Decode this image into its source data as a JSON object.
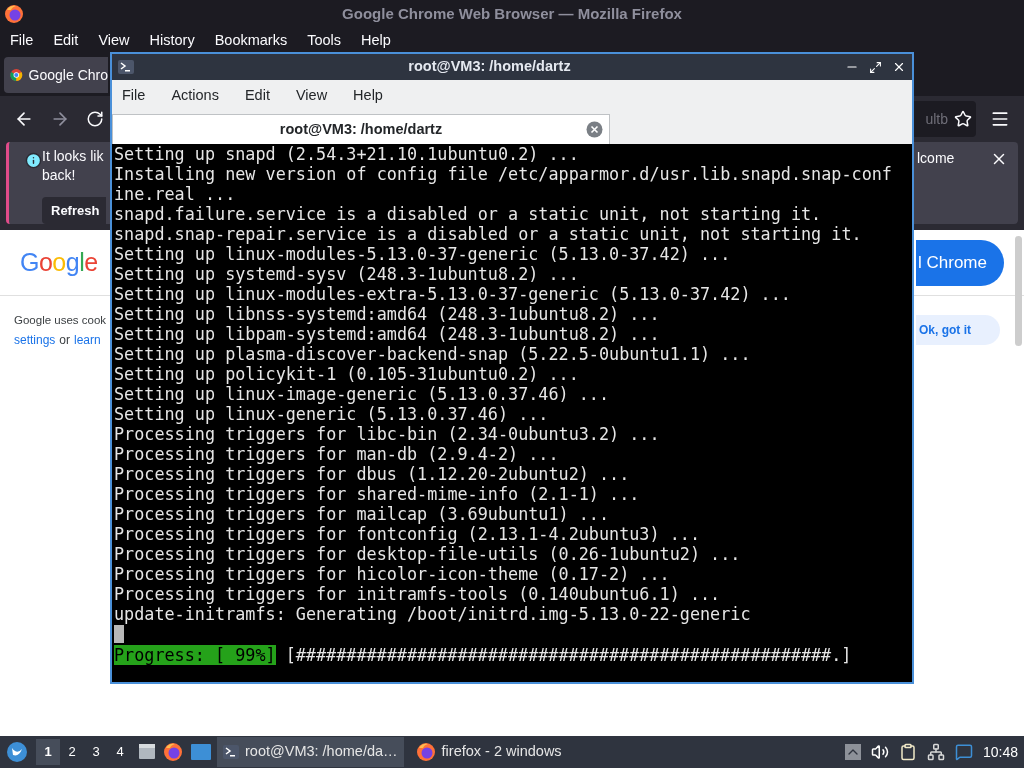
{
  "firefox": {
    "title": "Google Chrome Web Browser — Mozilla Firefox",
    "menu": [
      "File",
      "Edit",
      "View",
      "History",
      "Bookmarks",
      "Tools",
      "Help"
    ],
    "tab": {
      "label": "Google Chro"
    },
    "url_fragment": "ultb",
    "notification": {
      "lines": [
        "It looks lik",
        "back!"
      ],
      "button": "Refresh",
      "fragment": "lcome"
    },
    "page": {
      "logo": "Google",
      "install_button": "l Chrome",
      "cookie_text": "Google uses cook",
      "cookie_links": [
        {
          "text": "settings",
          "kind": "link"
        },
        {
          "text": "or",
          "kind": "plain"
        },
        {
          "text": "learn",
          "kind": "link"
        }
      ],
      "ok_button": "Ok, got it"
    }
  },
  "terminal": {
    "title": "root@VM3: /home/dartz",
    "menu": [
      "File",
      "Actions",
      "Edit",
      "View",
      "Help"
    ],
    "tab": {
      "label": "root@VM3: /home/dartz"
    },
    "lines": [
      "Setting up snapd (2.54.3+21.10.1ubuntu0.2) ...",
      "Installing new version of config file /etc/apparmor.d/usr.lib.snapd.snap-conf",
      "ine.real ...",
      "snapd.failure.service is a disabled or a static unit, not starting it.",
      "snapd.snap-repair.service is a disabled or a static unit, not starting it.",
      "Setting up linux-modules-5.13.0-37-generic (5.13.0-37.42) ...",
      "Setting up systemd-sysv (248.3-1ubuntu8.2) ...",
      "Setting up linux-modules-extra-5.13.0-37-generic (5.13.0-37.42) ...",
      "Setting up libnss-systemd:amd64 (248.3-1ubuntu8.2) ...",
      "Setting up libpam-systemd:amd64 (248.3-1ubuntu8.2) ...",
      "Setting up plasma-discover-backend-snap (5.22.5-0ubuntu1.1) ...",
      "Setting up policykit-1 (0.105-31ubuntu0.2) ...",
      "Setting up linux-image-generic (5.13.0.37.46) ...",
      "Setting up linux-generic (5.13.0.37.46) ...",
      "Processing triggers for libc-bin (2.34-0ubuntu3.2) ...",
      "Processing triggers for man-db (2.9.4-2) ...",
      "Processing triggers for dbus (1.12.20-2ubuntu2) ...",
      "Processing triggers for shared-mime-info (2.1-1) ...",
      "Processing triggers for mailcap (3.69ubuntu1) ...",
      "Processing triggers for fontconfig (2.13.1-4.2ubuntu3) ...",
      "Processing triggers for desktop-file-utils (0.26-1ubuntu2) ...",
      "Processing triggers for hicolor-icon-theme (0.17-2) ...",
      "Processing triggers for initramfs-tools (0.140ubuntu6.1) ...",
      "update-initramfs: Generating /boot/initrd.img-5.13.0-22-generic"
    ],
    "cursor_visible": true,
    "progress": {
      "label": "Progress: [ 99%]",
      "bar": "[#####################################################.]"
    }
  },
  "taskbar": {
    "workspaces": [
      {
        "label": "1",
        "selected": true
      },
      {
        "label": "2",
        "selected": false
      },
      {
        "label": "3",
        "selected": false
      },
      {
        "label": "4",
        "selected": false
      }
    ],
    "tasks": [
      {
        "label": "root@VM3: /home/da…",
        "kind": "terminal",
        "selected": true
      },
      {
        "label": "firefox - 2 windows",
        "kind": "firefox",
        "selected": false
      }
    ],
    "clock": "10:48"
  }
}
